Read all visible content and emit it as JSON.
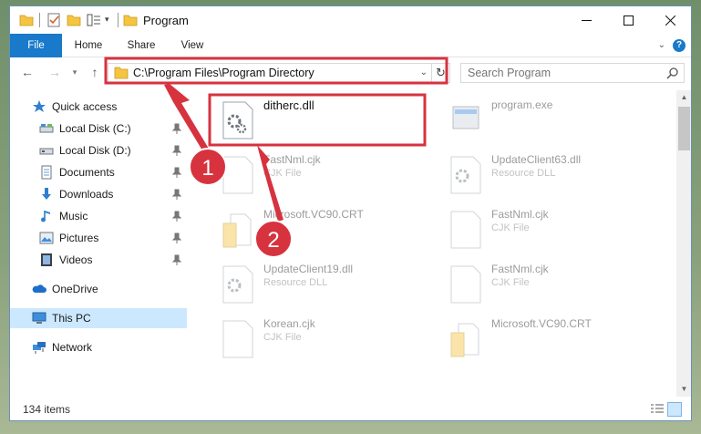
{
  "window": {
    "title": "Program",
    "tabs": [
      "File",
      "Home",
      "Share",
      "View"
    ],
    "controls": {
      "minimize_icon": "minimize-icon",
      "maximize_icon": "maximize-icon",
      "close_icon": "close-icon"
    }
  },
  "nav": {
    "address": "C:\\Program Files\\Program Directory",
    "search_placeholder": "Search Program"
  },
  "sidebar": {
    "items": [
      {
        "label": "Quick access",
        "icon": "star-icon",
        "pinned": false
      },
      {
        "label": "Local Disk (C:)",
        "icon": "drive-icon",
        "pinned": true
      },
      {
        "label": "Local Disk (D:)",
        "icon": "drive-icon",
        "pinned": true
      },
      {
        "label": "Documents",
        "icon": "documents-icon",
        "pinned": true
      },
      {
        "label": "Downloads",
        "icon": "download-icon",
        "pinned": true
      },
      {
        "label": "Music",
        "icon": "music-icon",
        "pinned": true
      },
      {
        "label": "Pictures",
        "icon": "pictures-icon",
        "pinned": true
      },
      {
        "label": "Videos",
        "icon": "videos-icon",
        "pinned": true
      },
      {
        "label": "OneDrive",
        "icon": "cloud-icon",
        "pinned": false
      },
      {
        "label": "This PC",
        "icon": "computer-icon",
        "pinned": false,
        "selected": true
      },
      {
        "label": "Network",
        "icon": "network-icon",
        "pinned": false
      }
    ]
  },
  "files": [
    {
      "name": "ditherc.dll",
      "type": "",
      "icon": "dll-gear-icon",
      "highlighted": true
    },
    {
      "name": "program.exe",
      "type": "",
      "icon": "exe-icon",
      "highlighted": false
    },
    {
      "name": "FastNml.cjk",
      "type": "CJK File",
      "icon": "file-icon",
      "highlighted": false
    },
    {
      "name": "UpdateClient63.dll",
      "type": "Resource DLL",
      "icon": "dll-gear-icon",
      "highlighted": false
    },
    {
      "name": "Microsoft.VC90.CRT",
      "type": "",
      "icon": "folder-icon",
      "highlighted": false
    },
    {
      "name": "FastNml.cjk",
      "type": "CJK File",
      "icon": "file-icon",
      "highlighted": false
    },
    {
      "name": "UpdateClient19.dll",
      "type": "Resource DLL",
      "icon": "dll-gear-icon",
      "highlighted": false
    },
    {
      "name": "FastNml.cjk",
      "type": "CJK File",
      "icon": "file-icon",
      "highlighted": false
    },
    {
      "name": "Korean.cjk",
      "type": "CJK File",
      "icon": "file-icon",
      "highlighted": false
    },
    {
      "name": "Microsoft.VC90.CRT",
      "type": "",
      "icon": "folder-icon",
      "highlighted": false
    }
  ],
  "status": {
    "item_count": "134 items"
  },
  "annotations": {
    "step1": "1",
    "step2": "2"
  },
  "colors": {
    "accent": "#1979ca",
    "callout_red": "#d6333f",
    "selected_bg": "#cce8ff"
  }
}
